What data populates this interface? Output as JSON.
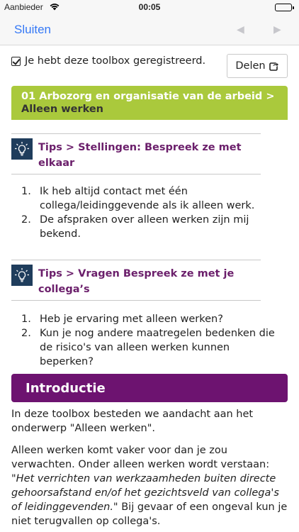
{
  "status_bar": {
    "carrier": "Aanbieder",
    "time": "00:05"
  },
  "nav": {
    "close_label": "Sluiten",
    "prev_arrow": "◀",
    "next_arrow": "▶"
  },
  "registration": {
    "text": "Je hebt deze toolbox geregistreerd."
  },
  "share": {
    "label": "Delen",
    "icon": "share-icon"
  },
  "breadcrumb": {
    "section": "01 Arbozorg en organisatie van de arbeid",
    "separator": ">",
    "current": "Alleen werken"
  },
  "tips": [
    {
      "title": "Tips > Stellingen: Bespreek ze met elkaar",
      "icon": "lightbulb-icon",
      "items": [
        {
          "num": "1.",
          "text": "Ik heb altijd contact met één collega/leidinggevende als ik alleen werk."
        },
        {
          "num": "2.",
          "text": "De afspraken over alleen werken zijn mij bekend."
        }
      ]
    },
    {
      "title": "Tips > Vragen Bespreek ze met je collega’s",
      "icon": "lightbulb-icon",
      "items": [
        {
          "num": "1.",
          "text": "Heb je ervaring met alleen werken?"
        },
        {
          "num": "2.",
          "text": "Kun je nog andere maatregelen bedenken die de risico's van alleen werken kunnen beperken?"
        }
      ]
    }
  ],
  "intro": {
    "heading": "Introductie",
    "p1": "In deze toolbox besteden we aandacht aan het onderwerp \"Alleen werken\".",
    "p2_start": "Alleen werken komt vaker voor dan je zou verwachten. Onder alleen werken wordt verstaan: ",
    "p2_quote": "\"Het verrichten van werkzaamheden buiten directe gehoorsafstand en/of het gezichtsveld van collega's of leidinggevenden.\"",
    "p2_end": " Bij gevaar of een ongeval kun je niet terugvallen op collega's."
  },
  "colors": {
    "accent_blue": "#3478f6",
    "breadcrumb_green": "#aac93c",
    "tip_purple": "#6b1f6b",
    "intro_purple": "#6d1370",
    "icon_navy": "#1f3d5c"
  }
}
